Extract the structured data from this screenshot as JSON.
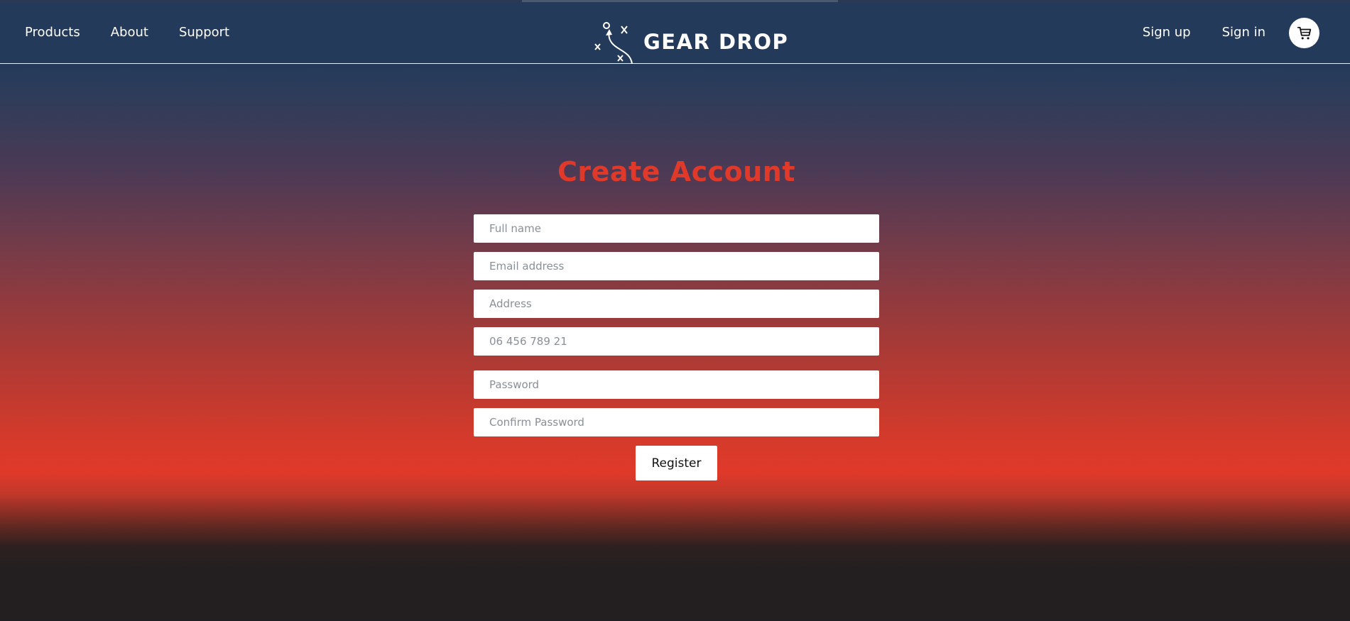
{
  "brand": {
    "name": "GEAR DROP",
    "logo_icon": "playbook-icon"
  },
  "nav": {
    "left": [
      {
        "label": "Products"
      },
      {
        "label": "About"
      },
      {
        "label": "Support"
      }
    ],
    "right": [
      {
        "label": "Sign up"
      },
      {
        "label": "Sign in"
      }
    ],
    "cart_icon": "cart-icon"
  },
  "page": {
    "title": "Create Account"
  },
  "form": {
    "full_name": {
      "placeholder": "Full name",
      "value": ""
    },
    "email": {
      "placeholder": "Email address",
      "value": ""
    },
    "address": {
      "placeholder": "Address",
      "value": ""
    },
    "phone": {
      "placeholder": "06 456 789 21",
      "value": ""
    },
    "password": {
      "placeholder": "Password",
      "value": ""
    },
    "confirm_password": {
      "placeholder": "Confirm Password",
      "value": ""
    },
    "submit_label": "Register"
  },
  "colors": {
    "header_bg": "#243a5a",
    "accent": "#e0392a",
    "footer_dark": "#231f20"
  }
}
